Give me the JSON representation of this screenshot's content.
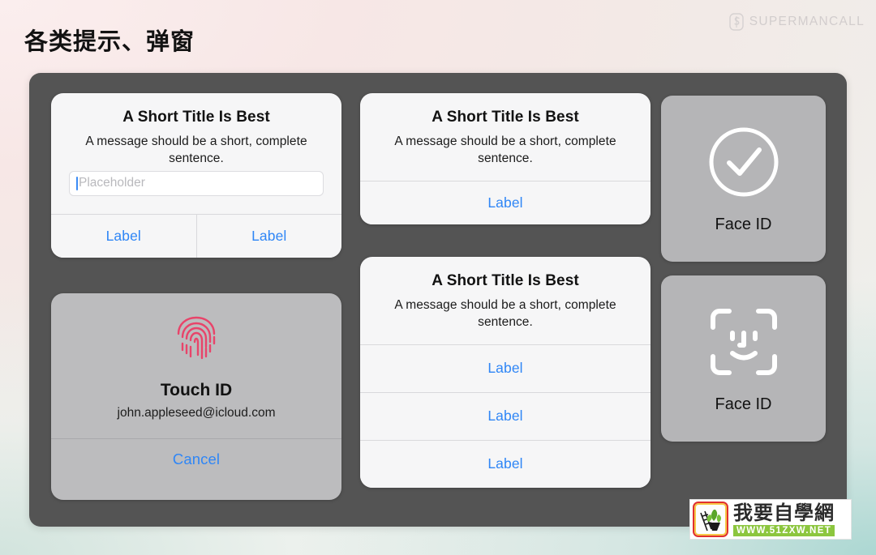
{
  "header": {
    "title": "各类提示、弹窗",
    "brand": "SUPERMANCALL",
    "brand_icon": "s-logo-icon"
  },
  "colors": {
    "accent_blue": "#2f86f6",
    "stage_bg": "#545454",
    "alert_bg": "#f6f6f7",
    "panel_gray": "#b5b5b7",
    "touchid_gray": "#bcbcbe",
    "fingerprint": "#e8446a",
    "divider": "#d9d9dc"
  },
  "alert_textfield": {
    "title": "A Short Title Is Best",
    "message": "A message should be a short, complete sentence.",
    "input_placeholder": "Placeholder",
    "input_value": "",
    "buttons": [
      "Label",
      "Label"
    ]
  },
  "touchid": {
    "icon": "fingerprint-icon",
    "title": "Touch ID",
    "account": "john.appleseed@icloud.com",
    "cancel_label": "Cancel"
  },
  "alert_one_button": {
    "title": "A Short Title Is Best",
    "message": "A message should be a short, complete sentence.",
    "buttons": [
      "Label"
    ]
  },
  "alert_three_buttons": {
    "title": "A Short Title Is Best",
    "message": "A message should be a short, complete sentence.",
    "buttons": [
      "Label",
      "Label",
      "Label"
    ]
  },
  "faceid_success": {
    "icon": "checkmark-circle-icon",
    "label": "Face ID"
  },
  "faceid_scan": {
    "icon": "faceid-scan-icon",
    "label": "Face ID"
  },
  "watermark": {
    "name": "我要自學網",
    "url": "WWW.51ZXW.NET"
  }
}
